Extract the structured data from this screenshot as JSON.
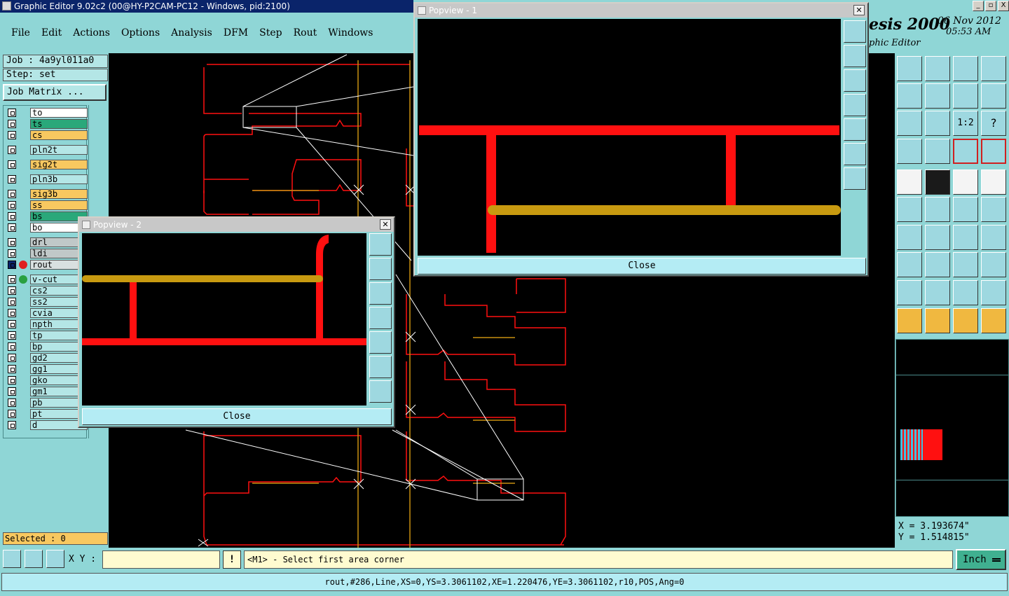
{
  "window": {
    "title": "Graphic Editor 9.02c2 (00@HY-P2CAM-PC12 - Windows, pid:2100)",
    "controls": [
      "_",
      "▫",
      "X"
    ]
  },
  "menu": [
    "File",
    "Edit",
    "Actions",
    "Options",
    "Analysis",
    "DFM",
    "Step",
    "Rout",
    "Windows"
  ],
  "brand": {
    "name": "esis 2000",
    "date": "06 Nov 2012",
    "time": "05:53 AM",
    "subtitle": "phic Editor"
  },
  "left": {
    "job": "Job : 4a9yl011a0",
    "step": "Step: set",
    "job_matrix": "Job Matrix ...",
    "selected": "Selected : 0"
  },
  "layers": [
    {
      "name": "to",
      "color": "#ffffff"
    },
    {
      "name": "ts",
      "color": "#2aa87a"
    },
    {
      "name": "cs",
      "color": "#f8c860"
    },
    {
      "name": "pln2t",
      "color": "#b4e6e6"
    },
    {
      "name": "sig2t",
      "color": "#f8c860"
    },
    {
      "name": "pln3b",
      "color": "#b4e6e6"
    },
    {
      "name": "sig3b",
      "color": "#f8c860"
    },
    {
      "name": "ss",
      "color": "#f8c860"
    },
    {
      "name": "bs",
      "color": "#2aa87a"
    },
    {
      "name": "bo",
      "color": "#ffffff"
    },
    {
      "name": "drl",
      "color": "#c0c8c8"
    },
    {
      "name": "ldi",
      "color": "#c0c8c8"
    },
    {
      "name": "rout",
      "color": "#d8e0e0",
      "dot": "#e02020"
    },
    {
      "name": "v-cut",
      "color": "#b4e6e6",
      "dot": "#2aa040"
    },
    {
      "name": "cs2",
      "color": "#b4e6e6"
    },
    {
      "name": "ss2",
      "color": "#b4e6e6"
    },
    {
      "name": "cvia",
      "color": "#b4e6e6"
    },
    {
      "name": "npth",
      "color": "#b4e6e6"
    },
    {
      "name": "tp",
      "color": "#b4e6e6"
    },
    {
      "name": "bp",
      "color": "#b4e6e6"
    },
    {
      "name": "gd2",
      "color": "#b4e6e6"
    },
    {
      "name": "gg1",
      "color": "#b4e6e6"
    },
    {
      "name": "gko",
      "color": "#b4e6e6"
    },
    {
      "name": "gm1",
      "color": "#b4e6e6"
    },
    {
      "name": "pb",
      "color": "#b4e6e6"
    },
    {
      "name": "pt",
      "color": "#b4e6e6"
    },
    {
      "name": "d",
      "color": "#b4e6e6"
    }
  ],
  "popup1": {
    "title": "Popview - 1",
    "close": "Close"
  },
  "popup2": {
    "title": "Popview - 2",
    "close": "Close"
  },
  "coords": {
    "x": "X = 3.193674\"",
    "y": "Y = 1.514815\""
  },
  "bottom": {
    "xy_label": "X Y :",
    "xy_value": "",
    "message": "<M1> - Select first area corner",
    "units": "Inch",
    "status": "rout,#286,Line,XS=0,YS=3.3061102,XE=1.220476,YE=3.3061102,r10,POS,Ang=0"
  },
  "colors": {
    "rout": "#ff1010",
    "vcut": "#c89010",
    "bg": "#8fd6d6"
  }
}
